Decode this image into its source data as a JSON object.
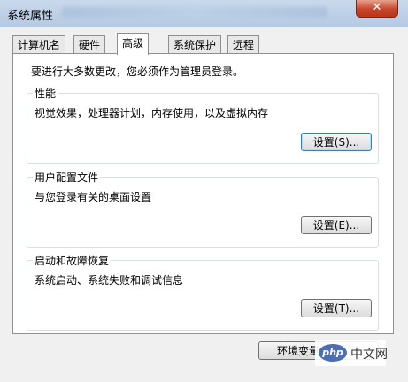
{
  "window": {
    "title": "系统属性",
    "close_glyph": "✕"
  },
  "tabs": [
    {
      "label": "计算机名",
      "active": false
    },
    {
      "label": "硬件",
      "active": false
    },
    {
      "label": "高级",
      "active": true
    },
    {
      "label": "系统保护",
      "active": false
    },
    {
      "label": "远程",
      "active": false
    }
  ],
  "admin_note": "要进行大多数更改，您必须作为管理员登录。",
  "performance": {
    "title": "性能",
    "description": "视觉效果，处理器计划，内存使用，以及虚拟内存",
    "button_label": "设置(S)..."
  },
  "user_profiles": {
    "title": "用户配置文件",
    "description": "与您登录有关的桌面设置",
    "button_label": "设置(E)..."
  },
  "startup_recovery": {
    "title": "启动和故障恢复",
    "description": "系统启动、系统失败和调试信息",
    "button_label": "设置(T)..."
  },
  "env_vars_button": "环境变量",
  "watermark": {
    "badge": "php",
    "text": "中文网"
  }
}
